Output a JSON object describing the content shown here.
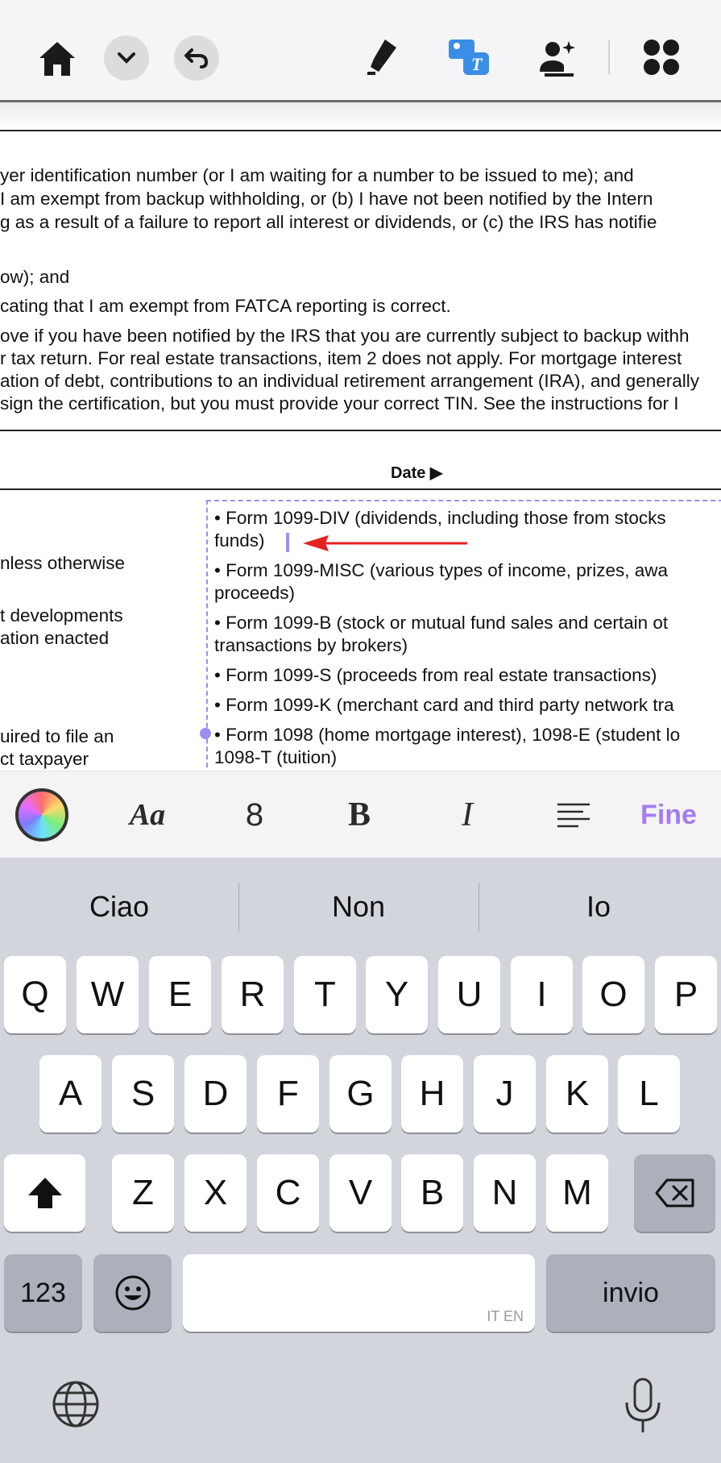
{
  "toolbar": {
    "icons": [
      "home-icon",
      "chevron-down-icon",
      "undo-icon",
      "highlighter-icon",
      "text-image-icon",
      "add-signature-icon",
      "grid-menu-icon"
    ],
    "accent": "#3a8ee6"
  },
  "document": {
    "lines_top": [
      "yer identification number (or I am waiting for a number to be issued to me); and",
      "I am exempt from backup withholding, or (b) I have not been notified by the Intern",
      "g as a result of a failure to report all interest or dividends, or (c) the IRS has notifie"
    ],
    "lines_mid": [
      "ow); and",
      "cating that I am exempt from FATCA reporting is correct."
    ],
    "lines_para": [
      "ove if you have been notified by the IRS that you are currently subject to backup withh",
      "r tax return. For real estate transactions, item 2 does not apply. For mortgage interest",
      "ation of debt, contributions to an individual retirement arrangement (IRA), and generally",
      "sign the certification, but you must provide your correct TIN. See the instructions for I"
    ],
    "date_label": "Date ▶",
    "left_col": [
      "nless otherwise",
      "t developments",
      "ation enacted",
      "uired to file an",
      "ct taxpayer"
    ],
    "textbox_lines": [
      "• Form 1099-DIV (dividends, including those from stocks",
      "funds)",
      "• Form 1099-MISC (various types of income, prizes, awa",
      "proceeds)",
      "• Form 1099-B (stock or mutual fund sales and certain ot",
      "transactions by brokers)",
      "• Form 1099-S (proceeds from real estate transactions)",
      "• Form 1099-K (merchant card and third party network tra",
      "• Form 1098 (home mortgage interest), 1098-E (student lo",
      "1098-T (tuition)"
    ],
    "annotation_color": "#e32222",
    "selection_color": "#9f8df0"
  },
  "format_bar": {
    "font_label": "Aa",
    "size_value": "8",
    "bold_label": "B",
    "italic_label": "I",
    "done_label": "Fine",
    "done_color": "#a57cf0"
  },
  "keyboard": {
    "suggestions": [
      "Ciao",
      "Non",
      "Io"
    ],
    "row1": [
      "Q",
      "W",
      "E",
      "R",
      "T",
      "Y",
      "U",
      "I",
      "O",
      "P"
    ],
    "row2": [
      "A",
      "S",
      "D",
      "F",
      "G",
      "H",
      "J",
      "K",
      "L"
    ],
    "row3": [
      "Z",
      "X",
      "C",
      "V",
      "B",
      "N",
      "M"
    ],
    "numbers_label": "123",
    "return_label": "invio",
    "space_lang": "IT EN"
  }
}
